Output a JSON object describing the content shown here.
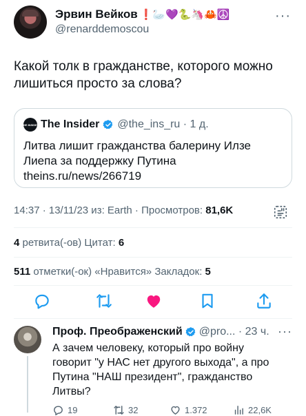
{
  "tweet": {
    "author_name": "Эрвин Вейков",
    "author_emojis": "❗🦢💜🐍🦄🦀☮️",
    "handle": "@renarddemoscou",
    "more_label": "···",
    "text": "Какой толк в гражданстве, которого можно лишиться просто за слова?",
    "quote": {
      "logo_text": "THE INSIDER",
      "name": "The Insider",
      "meta": "@the_ins_ru · 1 д.",
      "text": "Литва лишит гражданства балерину Илзе Лиепа за поддержку Путина theins.ru/news/266719"
    },
    "timestamp": "14:37 · 13/11/23 из: Earth · Просмотров: ",
    "views": "81,6K",
    "retweets_count": "4",
    "retweets_label": " ретвита(-ов)  Цитат: ",
    "quotes_count": "6",
    "likes_count": "511",
    "likes_label": " отметки(-ок) «Нравится»  Закладок: ",
    "bookmarks_count": "5"
  },
  "reply": {
    "author_name": "Проф. Преображенский",
    "meta": "@pro... · 23 ч.",
    "more_label": "···",
    "text": "А зачем человеку, который про войну говорит \"у НАС нет другого выхода\", а про Путина \"НАШ президент\", гражданство Литвы?",
    "replies": "19",
    "retweets": "32",
    "likes": "1.372",
    "views": "22,6K"
  },
  "colors": {
    "verified": "#1d9bf0",
    "like_active": "#f91880",
    "secondary_text": "#536471",
    "border": "#cfd9de"
  },
  "icons": [
    "reply-icon",
    "retweet-icon",
    "heart-icon",
    "bookmark-icon",
    "share-icon",
    "analytics-icon",
    "verified-icon",
    "views-icon"
  ]
}
